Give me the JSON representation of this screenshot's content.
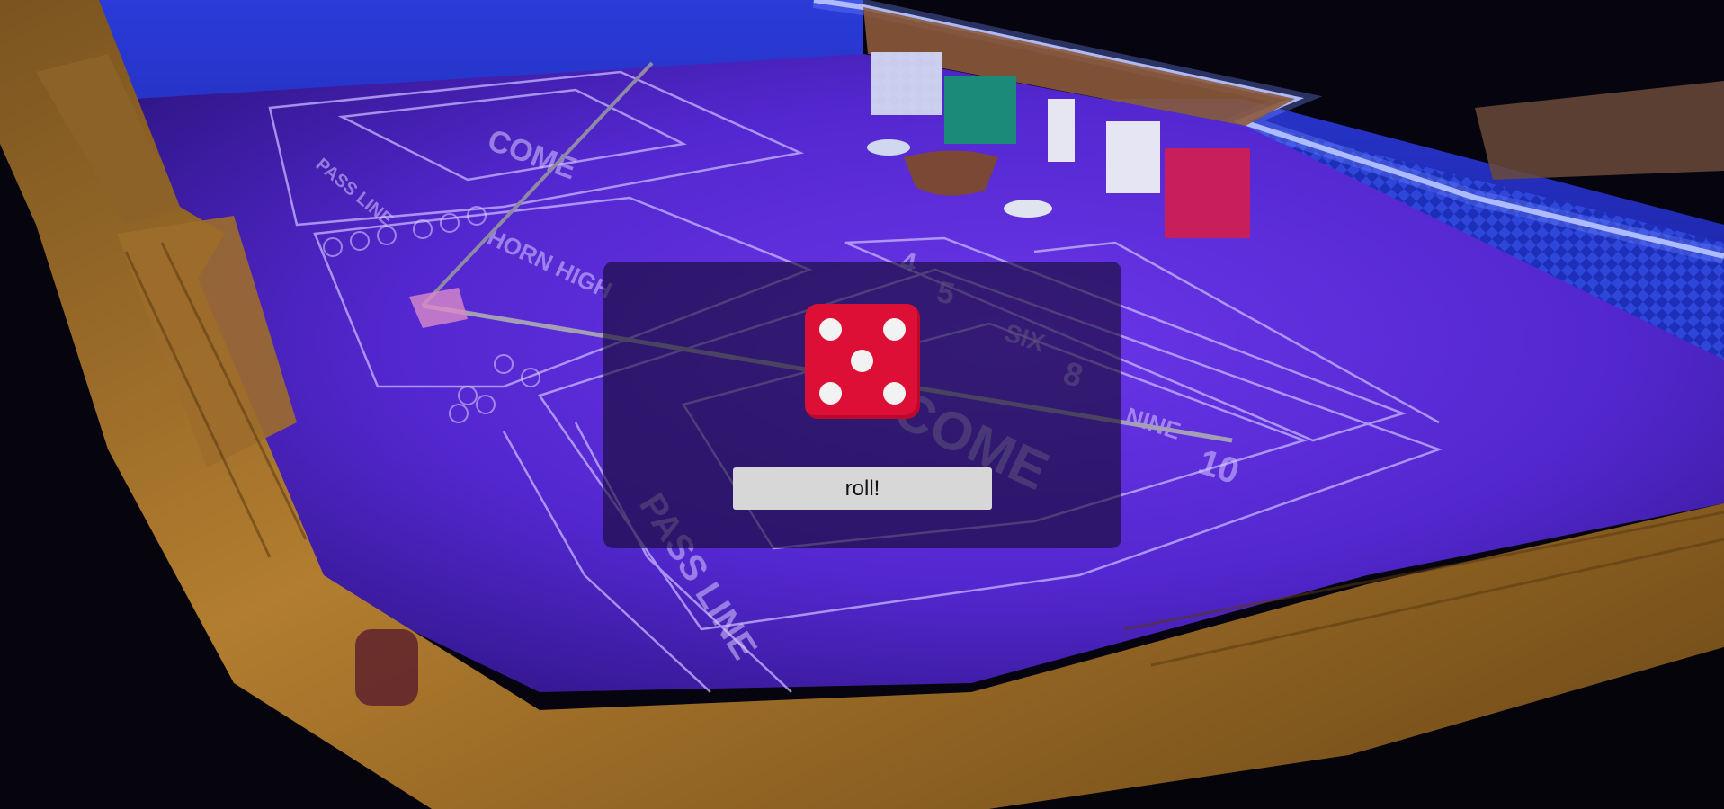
{
  "background": {
    "description_icon": "craps-table-photo",
    "colors": {
      "felt": "#5a2bd8",
      "rail_wood": "#a5742a",
      "led": "#c9d6ff"
    },
    "felt_labels": [
      "PASS LINE",
      "COME",
      "HORN HIGH",
      "SIX",
      "NINE",
      "4",
      "5",
      "8",
      "10",
      "PASS LINE",
      "COME"
    ]
  },
  "dialog": {
    "die": {
      "icon": "die-five-icon",
      "face_value": 5,
      "color": "#dd0f36",
      "pip_color": "#f2f2f2"
    },
    "roll_button_label": "roll!"
  }
}
